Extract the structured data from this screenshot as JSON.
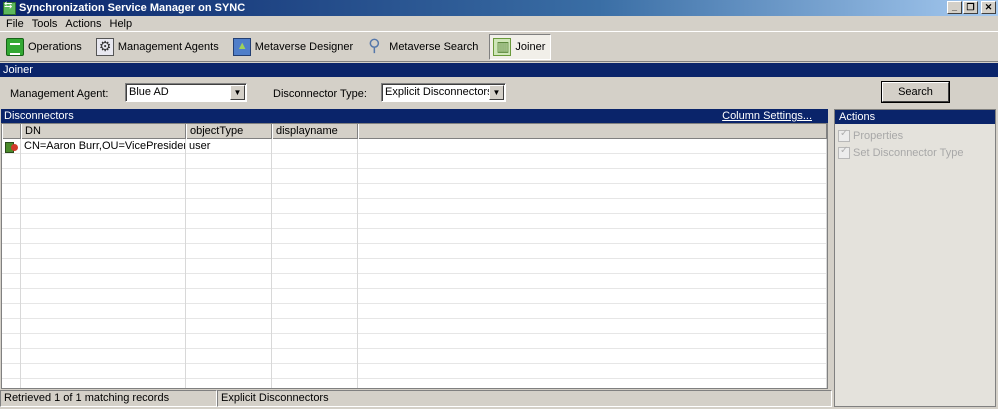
{
  "window": {
    "title": "Synchronization Service Manager on SYNC",
    "controls": {
      "minimize": "_",
      "restore": "❐",
      "close": "✕"
    }
  },
  "menu": [
    "File",
    "Tools",
    "Actions",
    "Help"
  ],
  "toolbar": {
    "buttons": [
      {
        "label": "Operations",
        "icon": "operations-icon"
      },
      {
        "label": "Management Agents",
        "icon": "management-agents-icon"
      },
      {
        "label": "Metaverse Designer",
        "icon": "metaverse-designer-icon"
      },
      {
        "label": "Metaverse Search",
        "icon": "metaverse-search-icon"
      },
      {
        "label": "Joiner",
        "icon": "joiner-icon",
        "active": true
      }
    ]
  },
  "joiner": {
    "header": "Joiner",
    "management_agent_label": "Management Agent:",
    "management_agent_value": "Blue AD",
    "disconnector_type_label": "Disconnector Type:",
    "disconnector_type_value": "Explicit Disconnectors",
    "search_label": "Search"
  },
  "disconnectors": {
    "header": "Disconnectors",
    "column_settings": "Column Settings...",
    "columns": [
      "DN",
      "objectType",
      "displayname"
    ],
    "rows": [
      {
        "dn": "CN=Aaron Burr,OU=VicePresidents,...",
        "objectType": "user",
        "displayname": ""
      }
    ]
  },
  "actions": {
    "header": "Actions",
    "items": [
      "Properties",
      "Set Disconnector Type"
    ]
  },
  "status": {
    "records": "Retrieved 1 of 1 matching records",
    "type": "Explicit Disconnectors"
  },
  "colors": {
    "header_bg": "#0a246a",
    "window_bg": "#d4d0c8",
    "disabled_text": "#a8a8a8"
  }
}
